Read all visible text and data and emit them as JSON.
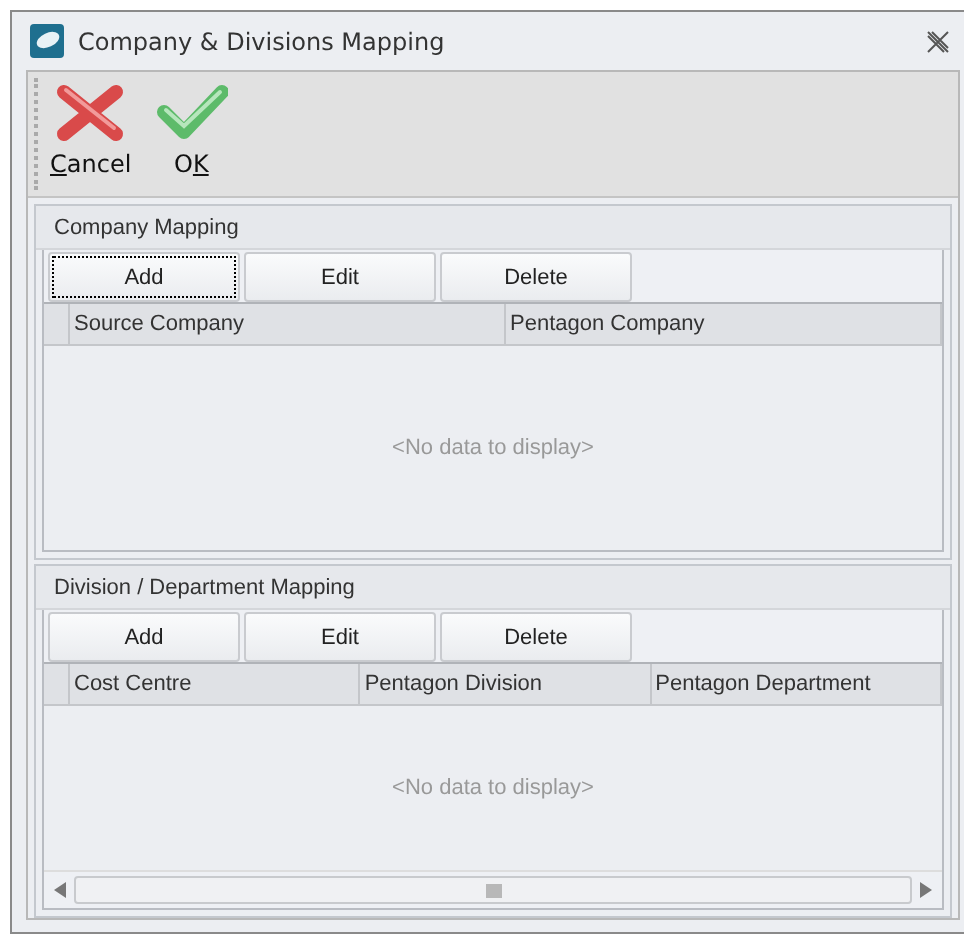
{
  "window": {
    "title": "Company & Divisions Mapping"
  },
  "toolbar": [
    {
      "kind": "cancel",
      "label": {
        "accel": "C",
        "after": "ancel"
      }
    },
    {
      "kind": "ok",
      "label": {
        "before": "O",
        "accel": "K"
      }
    }
  ],
  "sections": [
    {
      "title": "Company Mapping",
      "buttons": [
        {
          "label": "Add",
          "focused": true
        },
        {
          "label": "Edit",
          "focused": false
        },
        {
          "label": "Delete",
          "focused": false
        }
      ],
      "columns": [
        "Source Company",
        "Pentagon Company"
      ],
      "empty_text": "<No data to display>",
      "scrollbar": false
    },
    {
      "title": "Division / Department Mapping",
      "buttons": [
        {
          "label": "Add",
          "focused": false
        },
        {
          "label": "Edit",
          "focused": false
        },
        {
          "label": "Delete",
          "focused": false
        }
      ],
      "columns": [
        "Cost Centre",
        "Pentagon Division",
        "Pentagon Department"
      ],
      "empty_text": "<No data to display>",
      "scrollbar": true
    }
  ]
}
